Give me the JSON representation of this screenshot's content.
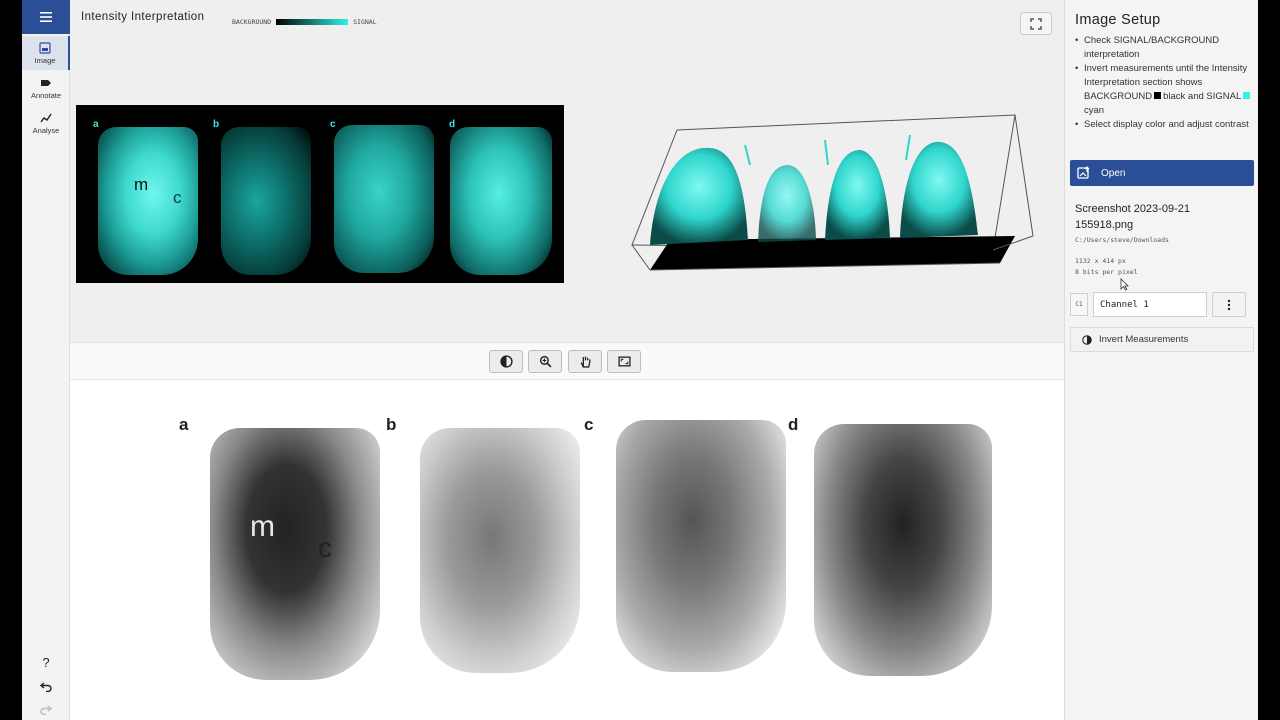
{
  "rail": {
    "items": [
      {
        "label": "Image",
        "icon": "image-icon"
      },
      {
        "label": "Annotate",
        "icon": "tag-icon"
      },
      {
        "label": "Analyse",
        "icon": "chart-line-icon"
      }
    ],
    "help_label": "?"
  },
  "viewer": {
    "intensity_title": "Intensity Interpretation",
    "legend_left": "BACKGROUND",
    "legend_right": "SIGNAL",
    "panel_letters": [
      "a",
      "b",
      "c",
      "d"
    ],
    "tissue_labels": {
      "m": "m",
      "c": "c"
    }
  },
  "toolbar": {
    "tools": [
      "contrast-icon",
      "zoom-icon",
      "pan-icon",
      "fit-image-icon"
    ]
  },
  "sidebar": {
    "title": "Image Setup",
    "instructions": {
      "line1": "Check SIGNAL/BACKGROUND interpretation",
      "line2_a": "Invert measurements until the Intensity Interpretation section shows BACKGROUND",
      "line2_b": "black and SIGNAL",
      "line2_c": "cyan",
      "line3": "Select display color and adjust contrast"
    },
    "open_label": "Open",
    "file_name": "Screenshot 2023-09-21 155918.png",
    "file_path": "C:/Users/steve/Downloads",
    "dimensions": "1132 x 414 px",
    "bit_depth": "8 bits per pixel",
    "channel_tag": "C1",
    "channel_name": "Channel 1",
    "invert_label": "Invert Measurements"
  },
  "colors": {
    "accent": "#2a4f97",
    "signal": "#2ef3e6",
    "background": "#000000"
  }
}
